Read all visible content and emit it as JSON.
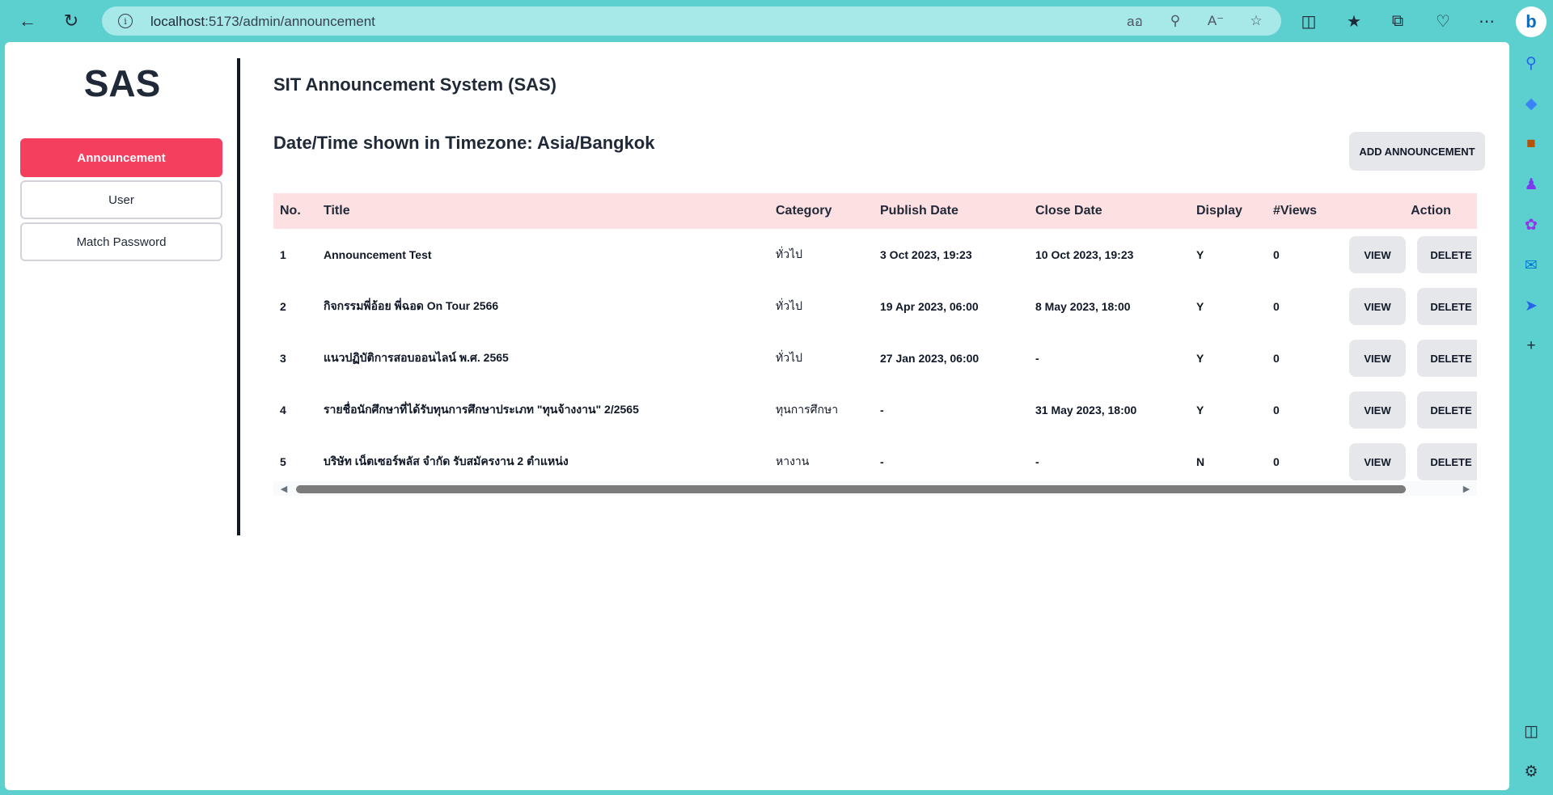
{
  "browser": {
    "url_host": "localhost",
    "url_path": ":5173/admin/announcement"
  },
  "sidebar": {
    "logo": "SAS",
    "items": [
      {
        "label": "Announcement",
        "active": true
      },
      {
        "label": "User",
        "active": false
      },
      {
        "label": "Match Password",
        "active": false
      }
    ]
  },
  "main": {
    "title": "SIT Announcement System (SAS)",
    "timezone_label": "Date/Time shown in Timezone: Asia/Bangkok",
    "add_button": "ADD ANNOUNCEMENT"
  },
  "table": {
    "headers": [
      "No.",
      "Title",
      "Category",
      "Publish Date",
      "Close Date",
      "Display",
      "#Views",
      "Action"
    ],
    "rows": [
      {
        "no": "1",
        "title": "Announcement Test",
        "category": "ทั่วไป",
        "publish": "3 Oct 2023, 19:23",
        "close": "10 Oct 2023, 19:23",
        "display": "Y",
        "views": "0"
      },
      {
        "no": "2",
        "title": "กิจกรรมพี่อ้อย พี่ฉอด On Tour 2566",
        "category": "ทั่วไป",
        "publish": "19 Apr 2023, 06:00",
        "close": "8 May 2023, 18:00",
        "display": "Y",
        "views": "0"
      },
      {
        "no": "3",
        "title": "แนวปฏิบัติการสอบออนไลน์ พ.ศ. 2565",
        "category": "ทั่วไป",
        "publish": "27 Jan 2023, 06:00",
        "close": "-",
        "display": "Y",
        "views": "0"
      },
      {
        "no": "4",
        "title": "รายชื่อนักศึกษาที่ได้รับทุนการศึกษาประเภท \"ทุนจ้างงาน\" 2/2565",
        "category": "ทุนการศึกษา",
        "publish": "-",
        "close": "31 May 2023, 18:00",
        "display": "Y",
        "views": "0"
      },
      {
        "no": "5",
        "title": "บริษัท เน็ตเซอร์พลัส จำกัด รับสมัครงาน 2 ตำแหน่ง",
        "category": "หางาน",
        "publish": "-",
        "close": "-",
        "display": "N",
        "views": "0"
      }
    ],
    "view_label": "VIEW",
    "delete_label": "DELETE"
  },
  "icons": {
    "back": "arrow-left-icon",
    "refresh": "refresh-icon",
    "site_info": "info-icon",
    "translate": "translate-icon",
    "zoom": "zoom-out-icon",
    "read_aloud": "read-aloud-icon",
    "favorite": "star-icon"
  },
  "colors": {
    "accent": "#f43f5e",
    "table_header_bg": "#fde0e2",
    "button_bg": "#e5e7eb",
    "browser_frame": "#5ccfcf"
  }
}
